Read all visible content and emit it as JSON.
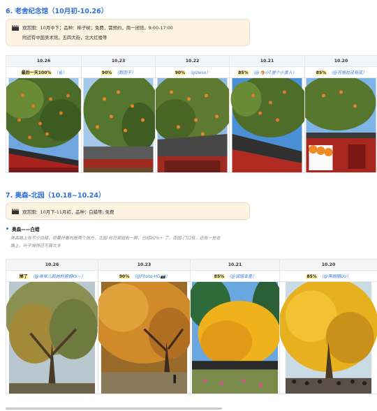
{
  "section6": {
    "heading": "6. 老舍纪念馆（10月初-10.26）",
    "callout_icon": "clapperboard-icon",
    "callout_line1": "观赏期：10月中下；品种：柿子树；免费，需预约，周一闭馆，9:00-17:00",
    "callout_line2": "附近有中国美术馆，五四大街，北大红楼等",
    "columns": [
      {
        "date": "10.26",
        "pct": "最后一天100%",
        "note": "（雀）"
      },
      {
        "date": "10.23",
        "pct": "90%",
        "note": "（鹅团子）"
      },
      {
        "date": "10.22",
        "pct": "90%",
        "note": "（qizwsx）"
      },
      {
        "date": "10.21",
        "pct": "85%",
        "note": "（@🐴小T是个小黄人）"
      },
      {
        "date": "10.20",
        "pct": "85%",
        "note": "（@苏格拉没有底）"
      }
    ]
  },
  "section7": {
    "heading": "7. 奥森-北园（10.18~10.24）",
    "callout_icon": "clapperboard-icon",
    "callout_line1": "观赏期：10月下-11月初，品种：白蜡等; 免费",
    "bullet_title": "奥森——白蜡",
    "para_line1": "奥森路上有不少白蜡，但最好看的是两个地方，北园-向日葵园有一颗，已经80%+ 了，南园-门口有，还有一些在",
    "para_line2": "路上，叶子掉得还不算太多",
    "columns": [
      {
        "date": "10.26",
        "pct": "掉了",
        "note": "（@咪咪儿和她的姐姐Kk~）"
      },
      {
        "date": "10.23",
        "pct": "90%",
        "note": "（@Photo-HG📷）"
      },
      {
        "date": "10.21",
        "pct": "85%",
        "note": "（@调随幸喜）"
      },
      {
        "date": "10.20",
        "pct": "85%",
        "note": "（@黑眼圈UU）"
      }
    ]
  },
  "colors": {
    "heading": "#2f6fd6",
    "callout_bg": "#fdf3e2",
    "highlight": "#fff3a6",
    "note": "#3b7be0"
  }
}
